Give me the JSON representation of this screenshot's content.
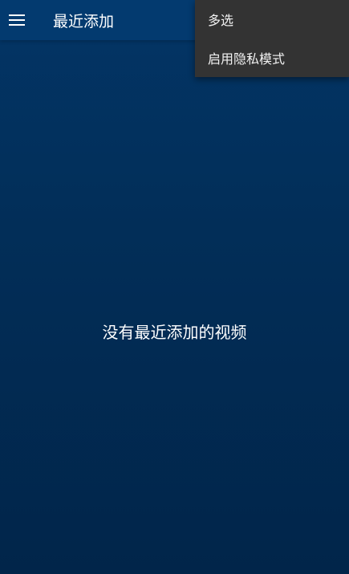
{
  "app_bar": {
    "title": "最近添加",
    "menu_icon": "hamburger-menu-icon"
  },
  "overflow_menu": {
    "items": [
      {
        "label": "多选"
      },
      {
        "label": "启用隐私模式"
      }
    ]
  },
  "main": {
    "empty_message": "没有最近添加的视频"
  },
  "colors": {
    "app_bar_bg": "#033a6f",
    "background_top": "#033566",
    "background_bottom": "#01254a",
    "menu_bg": "#333333"
  }
}
